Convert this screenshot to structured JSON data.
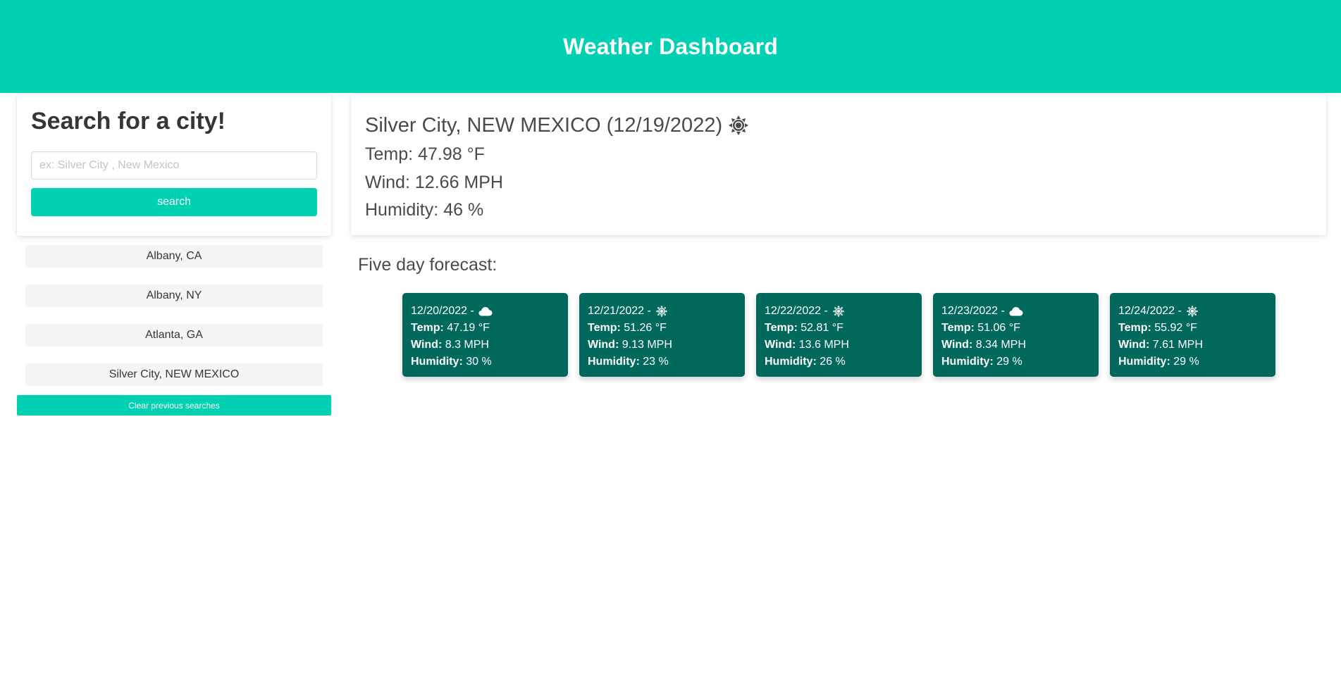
{
  "header": {
    "title": "Weather Dashboard"
  },
  "search": {
    "heading": "Search for a city!",
    "placeholder": "ex: Silver City , New Mexico",
    "button_label": "search"
  },
  "history": {
    "items": [
      "Albany, CA",
      "Albany, NY",
      "Atlanta, GA",
      "Silver City, NEW MEXICO"
    ],
    "clear_label": "Clear previous searches"
  },
  "current": {
    "title": "Silver City, NEW MEXICO (12/19/2022)",
    "icon": "sun-icon",
    "temp_label": "Temp:",
    "temp": "47.98 °F",
    "wind_label": "Wind:",
    "wind": "12.66 MPH",
    "humidity_label": "Humidity:",
    "humidity": "46 %"
  },
  "forecast": {
    "heading": "Five day forecast:",
    "days": [
      {
        "date": "12/20/2022 -",
        "icon": "cloud-icon",
        "temp_label": "Temp:",
        "temp": "47.19 °F",
        "wind_label": "Wind:",
        "wind": "8.3 MPH",
        "humidity_label": "Humidity:",
        "humidity": "30 %"
      },
      {
        "date": "12/21/2022 -",
        "icon": "sun-icon",
        "temp_label": "Temp:",
        "temp": "51.26 °F",
        "wind_label": "Wind:",
        "wind": "9.13 MPH",
        "humidity_label": "Humidity:",
        "humidity": "23 %"
      },
      {
        "date": "12/22/2022 -",
        "icon": "sun-icon",
        "temp_label": "Temp:",
        "temp": "52.81 °F",
        "wind_label": "Wind:",
        "wind": "13.6 MPH",
        "humidity_label": "Humidity:",
        "humidity": "26 %"
      },
      {
        "date": "12/23/2022 -",
        "icon": "cloud-icon",
        "temp_label": "Temp:",
        "temp": "51.06 °F",
        "wind_label": "Wind:",
        "wind": "8.34 MPH",
        "humidity_label": "Humidity:",
        "humidity": "29 %"
      },
      {
        "date": "12/24/2022 -",
        "icon": "sun-icon",
        "temp_label": "Temp:",
        "temp": "55.92 °F",
        "wind_label": "Wind:",
        "wind": "7.61 MPH",
        "humidity_label": "Humidity:",
        "humidity": "29 %"
      }
    ]
  },
  "colors": {
    "accent": "#00d1b2",
    "forecast_card": "#00695c",
    "text": "#363636"
  }
}
